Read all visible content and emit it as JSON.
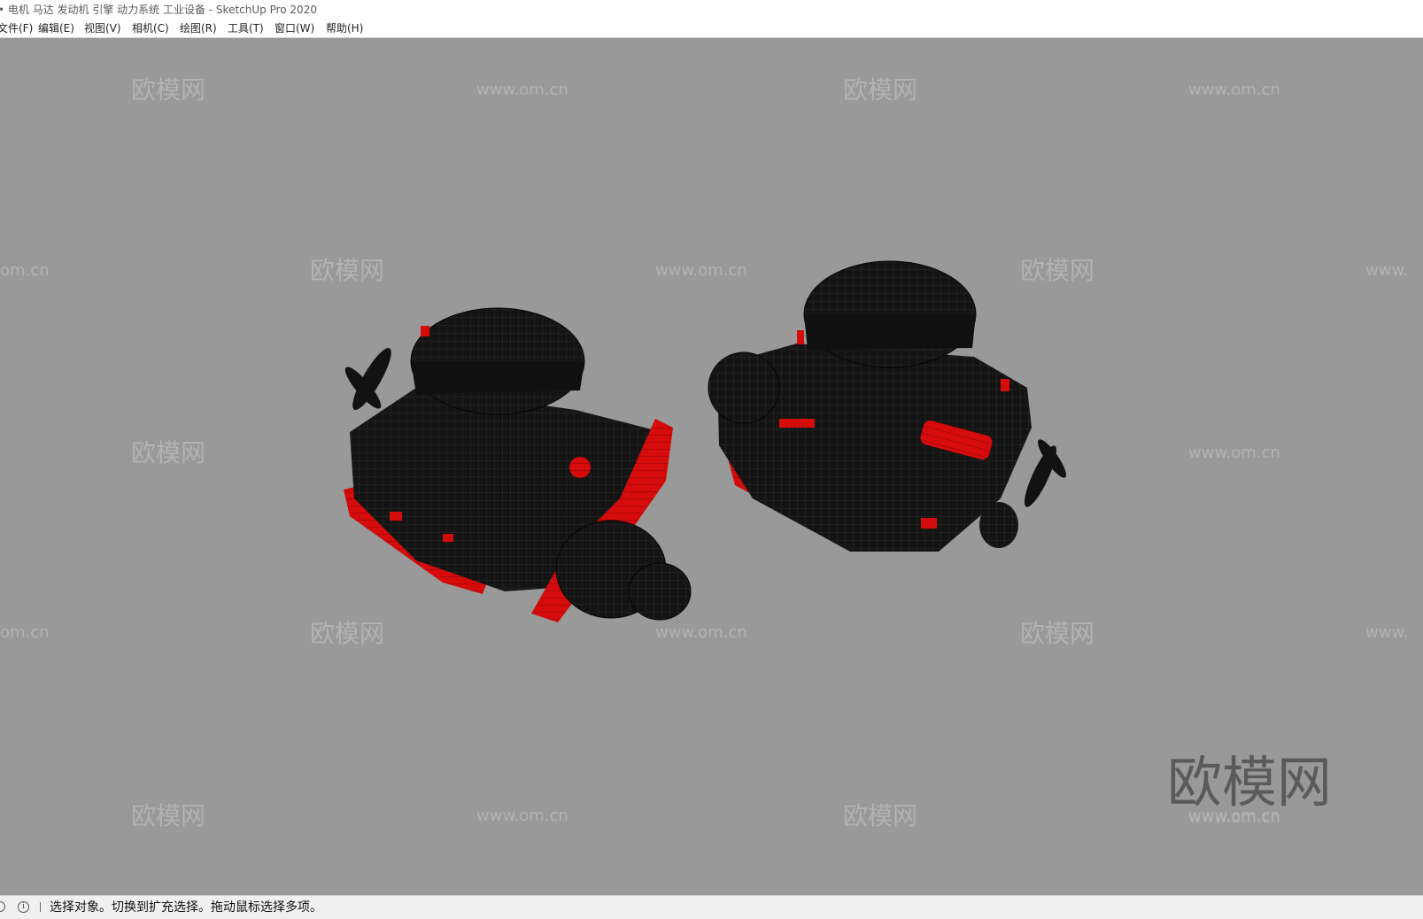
{
  "window": {
    "title": "• 电机 马达 发动机 引擎 动力系统 工业设备 - SketchUp Pro 2020"
  },
  "menu": {
    "items": [
      {
        "name": "menu-file",
        "label": "文件(F)"
      },
      {
        "name": "menu-edit",
        "label": "编辑(E)"
      },
      {
        "name": "menu-view",
        "label": "视图(V)"
      },
      {
        "name": "menu-camera",
        "label": "相机(C)"
      },
      {
        "name": "menu-draw",
        "label": "绘图(R)"
      },
      {
        "name": "menu-tools",
        "label": "工具(T)"
      },
      {
        "name": "menu-window",
        "label": "窗口(W)"
      },
      {
        "name": "menu-help",
        "label": "帮助(H)"
      }
    ]
  },
  "viewport": {
    "background": "#999999",
    "model_colors": {
      "body": "#121212",
      "accent": "#d60b0b"
    },
    "watermark": {
      "brand": "欧模网",
      "site": "www.om.cn",
      "site_partial": "om.cn",
      "site_partial_right": "www."
    },
    "logo": {
      "text": "欧模网",
      "site": "www.om.cn"
    }
  },
  "status": {
    "icons": [
      "geo-location-icon",
      "info-icon"
    ],
    "text": "选择对象。切换到扩充选择。拖动鼠标选择多项。"
  }
}
